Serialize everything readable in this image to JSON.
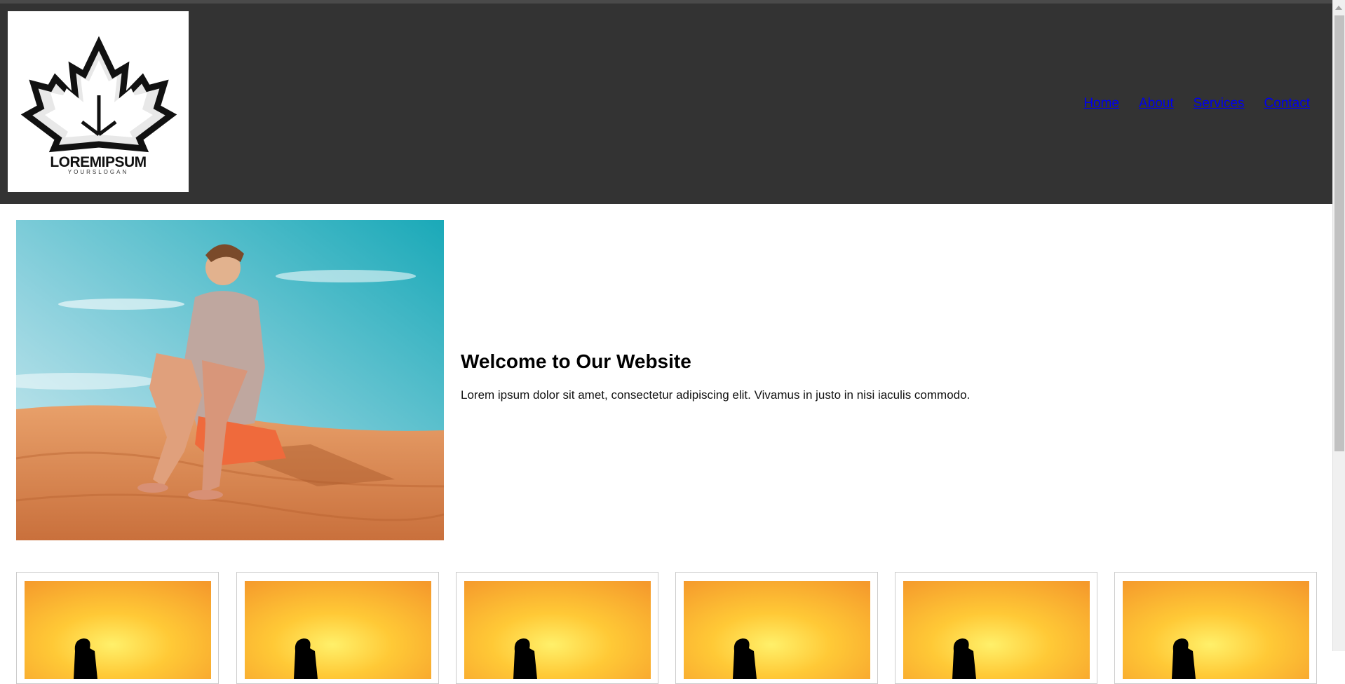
{
  "brand": {
    "name": "LOREMIPSUM",
    "slogan": "YOURSLOGAN"
  },
  "nav": {
    "items": [
      {
        "label": "Home"
      },
      {
        "label": "About"
      },
      {
        "label": "Services"
      },
      {
        "label": "Contact"
      }
    ]
  },
  "hero": {
    "heading": "Welcome to Our Website",
    "text": "Lorem ipsum dolor sit amet, consectetur adipiscing elit. Vivamus in justo in nisi iaculis commodo."
  },
  "colors": {
    "header_bg": "#333333",
    "link": "#0000ee",
    "card_border": "#cccccc"
  },
  "icons": {
    "logo": "maple-leaf-icon"
  },
  "cards_count_visible": 6
}
